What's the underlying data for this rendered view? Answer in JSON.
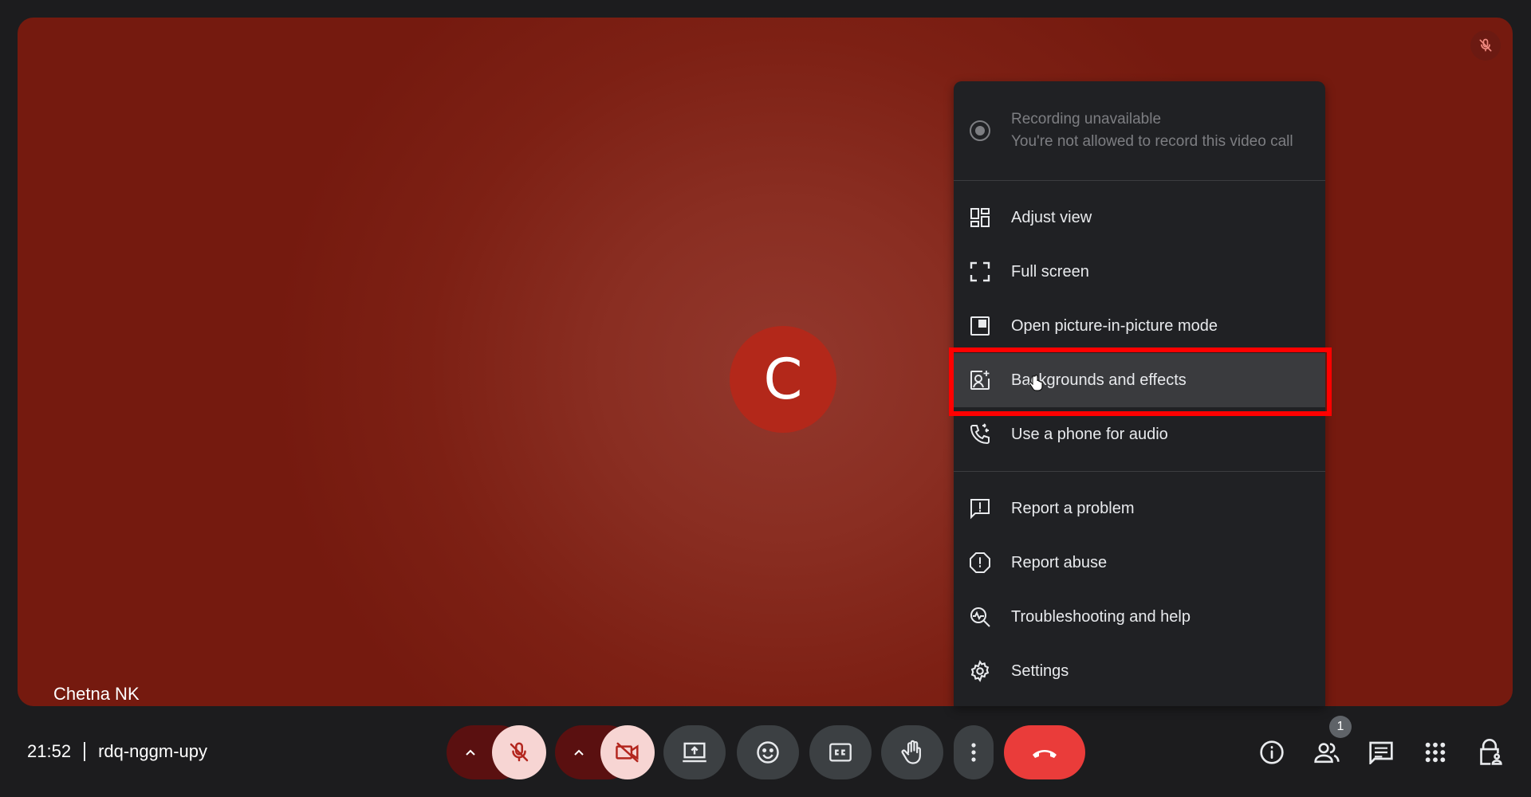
{
  "participant": {
    "name": "Chetna NK",
    "initial": "C"
  },
  "menu": {
    "recording": {
      "title": "Recording unavailable",
      "subtitle": "You're not allowed to record this video call"
    },
    "items": [
      {
        "label": "Adjust view",
        "icon": "grid-view-icon"
      },
      {
        "label": "Full screen",
        "icon": "fullscreen-icon"
      },
      {
        "label": "Open picture-in-picture mode",
        "icon": "picture-in-picture-icon"
      },
      {
        "label": "Backgrounds and effects",
        "icon": "backgrounds-effects-icon"
      },
      {
        "label": "Use a phone for audio",
        "icon": "phone-audio-icon"
      },
      {
        "label": "Report a problem",
        "icon": "feedback-icon"
      },
      {
        "label": "Report abuse",
        "icon": "report-icon"
      },
      {
        "label": "Troubleshooting and help",
        "icon": "troubleshoot-icon"
      },
      {
        "label": "Settings",
        "icon": "gear-icon"
      }
    ]
  },
  "meeting": {
    "time": "21:52",
    "code": "rdq-nggm-upy"
  },
  "people_count": "1",
  "colors": {
    "end_call": "#ea3c3a",
    "muted": "#f7d5d3",
    "tile": "#7d2014"
  }
}
